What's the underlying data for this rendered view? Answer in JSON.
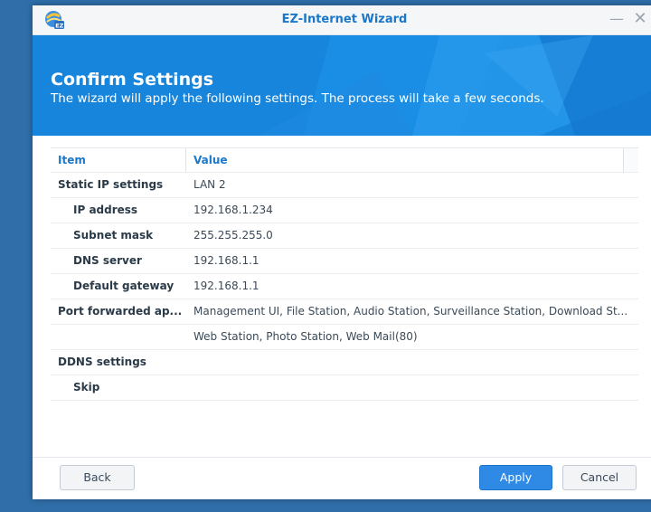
{
  "window": {
    "title": "EZ-Internet Wizard",
    "app_icon": "ez-internet-icon",
    "minimize_icon": "minimize-icon",
    "close_icon": "close-icon"
  },
  "banner": {
    "title": "Confirm Settings",
    "subtitle": "The wizard will apply the following settings. The process will take a few seconds."
  },
  "table": {
    "headers": {
      "item": "Item",
      "value": "Value"
    },
    "rows": [
      {
        "item": "Static IP settings",
        "value": "LAN 2",
        "indent": false
      },
      {
        "item": "IP address",
        "value": "192.168.1.234",
        "indent": true
      },
      {
        "item": "Subnet mask",
        "value": "255.255.255.0",
        "indent": true
      },
      {
        "item": "DNS server",
        "value": "192.168.1.1",
        "indent": true
      },
      {
        "item": "Default gateway",
        "value": "192.168.1.1",
        "indent": true
      },
      {
        "item": "Port forwarded ap...",
        "value": "Management UI, File Station, Audio Station, Surveillance Station, Download St...",
        "indent": false
      },
      {
        "item": "",
        "value": "Web Station, Photo Station, Web Mail(80)",
        "indent": false
      },
      {
        "item": "DDNS settings",
        "value": "",
        "indent": false
      },
      {
        "item": "Skip",
        "value": "",
        "indent": true
      }
    ]
  },
  "footer": {
    "back_label": "Back",
    "apply_label": "Apply",
    "cancel_label": "Cancel"
  },
  "colors": {
    "accent": "#1a77c9",
    "banner": "#1785dc",
    "apply_button": "#2f8ae6"
  }
}
